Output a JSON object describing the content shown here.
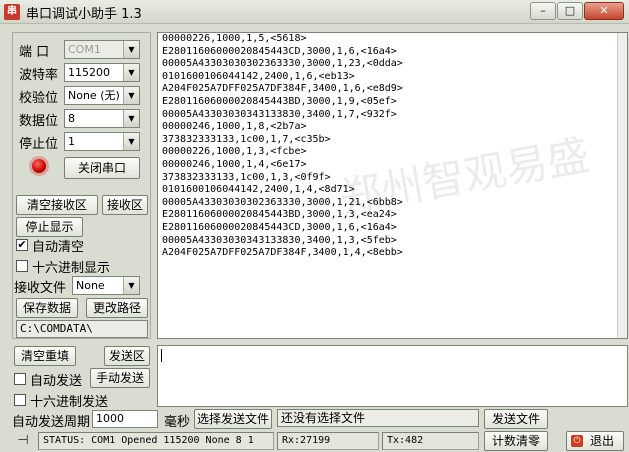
{
  "window": {
    "title": "串口调试小助手 1.3",
    "app_icon": "串",
    "min_symbol": "–",
    "max_symbol": "□",
    "close_symbol": "✕"
  },
  "settings": {
    "port_label": "端  口",
    "port_value": "COM1",
    "baud_label": "波特率",
    "baud_value": "115200",
    "parity_label": "校验位",
    "parity_value": "None (无)",
    "databits_label": "数据位",
    "databits_value": "8",
    "stopbits_label": "停止位",
    "stopbits_value": "1",
    "close_port_label": "关闭串口",
    "led_color": "#d40000"
  },
  "receive_controls": {
    "clear_recv_label": "清空接收区",
    "recv_area_label": "接收区",
    "stop_display_label": "停止显示",
    "auto_clear_label": "自动清空",
    "auto_clear_checked": "✔",
    "hex_display_label": "十六进制显示",
    "hex_display_checked": "",
    "recv_file_label": "接收文件",
    "recv_file_value": "None",
    "save_data_label": "保存数据",
    "change_path_label": "更改路径",
    "path_value": "C:\\COMDATA\\"
  },
  "receive": {
    "lines": "00000226,1000,1,5,<5618>\nE28011606000020845443CD,3000,1,6,<16a4>\n00005A43303030302363330,3000,1,23,<0dda>\n0101600106044142,2400,1,6,<eb13>\nA204F025A7DFF025A7DF384F,3400,1,6,<e8d9>\nE28011606000020845443BD,3000,1,9,<05ef>\n00005A43303030343133830,3400,1,7,<932f>\n00000246,1000,1,8,<2b7a>\n373832333133,1c00,1,7,<c35b>\n00000226,1000,1,3,<fcbe>\n00000246,1000,1,4,<6e17>\n373832333133,1c00,1,3,<0f9f>\n0101600106044142,2400,1,4,<8d71>\n00005A43303030302363330,3000,1,21,<6bb8>\nE28011606000020845443BD,3000,1,3,<ea24>\nE28011606000020845443CD,3000,1,6,<16a4>\n00005A43303030343133830,3400,1,3,<5feb>\nA204F025A7DFF025A7DF384F,3400,1,4,<8ebb>",
    "watermark": "郑州智观易盛"
  },
  "send_controls": {
    "clear_resend_label": "清空重填",
    "send_area_label": "发送区",
    "auto_send_label": "自动发送",
    "auto_send_checked": "",
    "manual_send_label": "手动发送",
    "hex_send_label": "十六进制发送",
    "hex_send_checked": "",
    "period_label": "自动发送周期",
    "period_value": "1000",
    "ms_label": "毫秒",
    "choose_file_label": "选择发送文件",
    "file_status": "还没有选择文件",
    "send_file_label": "发送文件",
    "count_clear_label": "计数清零",
    "exit_label": "退出"
  },
  "status": {
    "text": "STATUS: COM1 Opened 115200 None  8 1",
    "rx": "Rx:27199",
    "tx": "Tx:482"
  }
}
